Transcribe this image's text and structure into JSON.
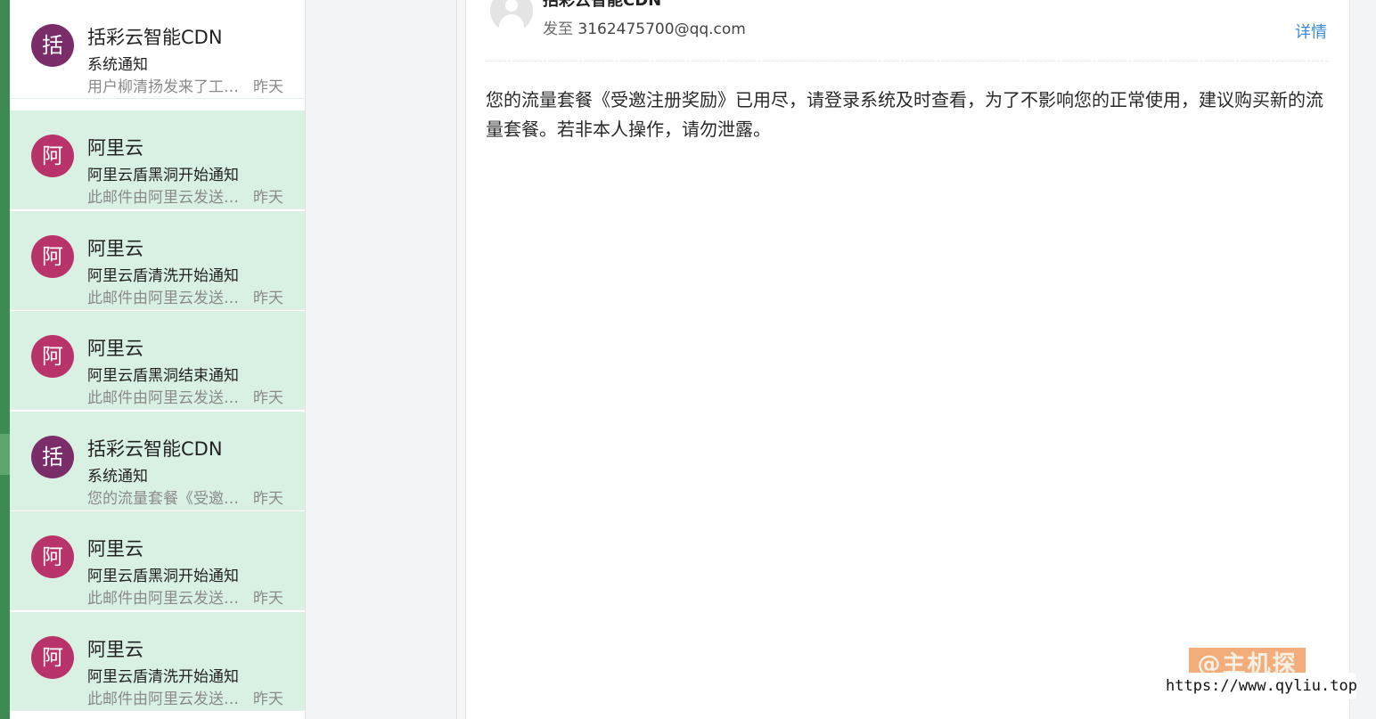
{
  "mail_list": {
    "items": [
      {
        "avatar_char": "括",
        "avatar_color": "#7b2d6a",
        "sender": "括彩云智能CDN",
        "subject": "系统通知",
        "preview": "用户柳清扬发来了工单回复",
        "time": "昨天",
        "state": "read"
      },
      {
        "avatar_char": "阿",
        "avatar_color": "#b8336a",
        "sender": "阿里云",
        "subject": "阿里云盾黑洞开始通知",
        "preview": "此邮件由阿里云发送，由系统自动发出",
        "time": "昨天",
        "state": "unread"
      },
      {
        "avatar_char": "阿",
        "avatar_color": "#b8336a",
        "sender": "阿里云",
        "subject": "阿里云盾清洗开始通知",
        "preview": "此邮件由阿里云发送，由系统自动发出",
        "time": "昨天",
        "state": "unread"
      },
      {
        "avatar_char": "阿",
        "avatar_color": "#b8336a",
        "sender": "阿里云",
        "subject": "阿里云盾黑洞结束通知",
        "preview": "此邮件由阿里云发送，由系统自动发出",
        "time": "昨天",
        "state": "unread"
      },
      {
        "avatar_char": "括",
        "avatar_color": "#7b2d6a",
        "sender": "括彩云智能CDN",
        "subject": "系统通知",
        "preview": "您的流量套餐《受邀注册奖励》已用尽",
        "time": "昨天",
        "state": "unread"
      },
      {
        "avatar_char": "阿",
        "avatar_color": "#b8336a",
        "sender": "阿里云",
        "subject": "阿里云盾黑洞开始通知",
        "preview": "此邮件由阿里云发送，由系统自动发出",
        "time": "昨天",
        "state": "unread"
      },
      {
        "avatar_char": "阿",
        "avatar_color": "#b8336a",
        "sender": "阿里云",
        "subject": "阿里云盾清洗开始通知",
        "preview": "此邮件由阿里云发送，由系统自动发出",
        "time": "昨天",
        "state": "unread"
      }
    ]
  },
  "reader": {
    "sender": "括彩云智能CDN",
    "to_label": "发至",
    "to_address": "3162475700@qq.com",
    "details_label": "详情",
    "body": "您的流量套餐《受邀注册奖励》已用尽，请登录系统及时查看，为了不影响您的正常使用，建议购买新的流量套餐。若非本人操作，请勿泄露。"
  },
  "watermark": {
    "label": "@主机探",
    "url": "https://www.qyliu.top"
  },
  "colors": {
    "accent_green": "#3d8a52",
    "unread_bg": "#d9f1e2",
    "link_blue": "#3a8bd6"
  }
}
